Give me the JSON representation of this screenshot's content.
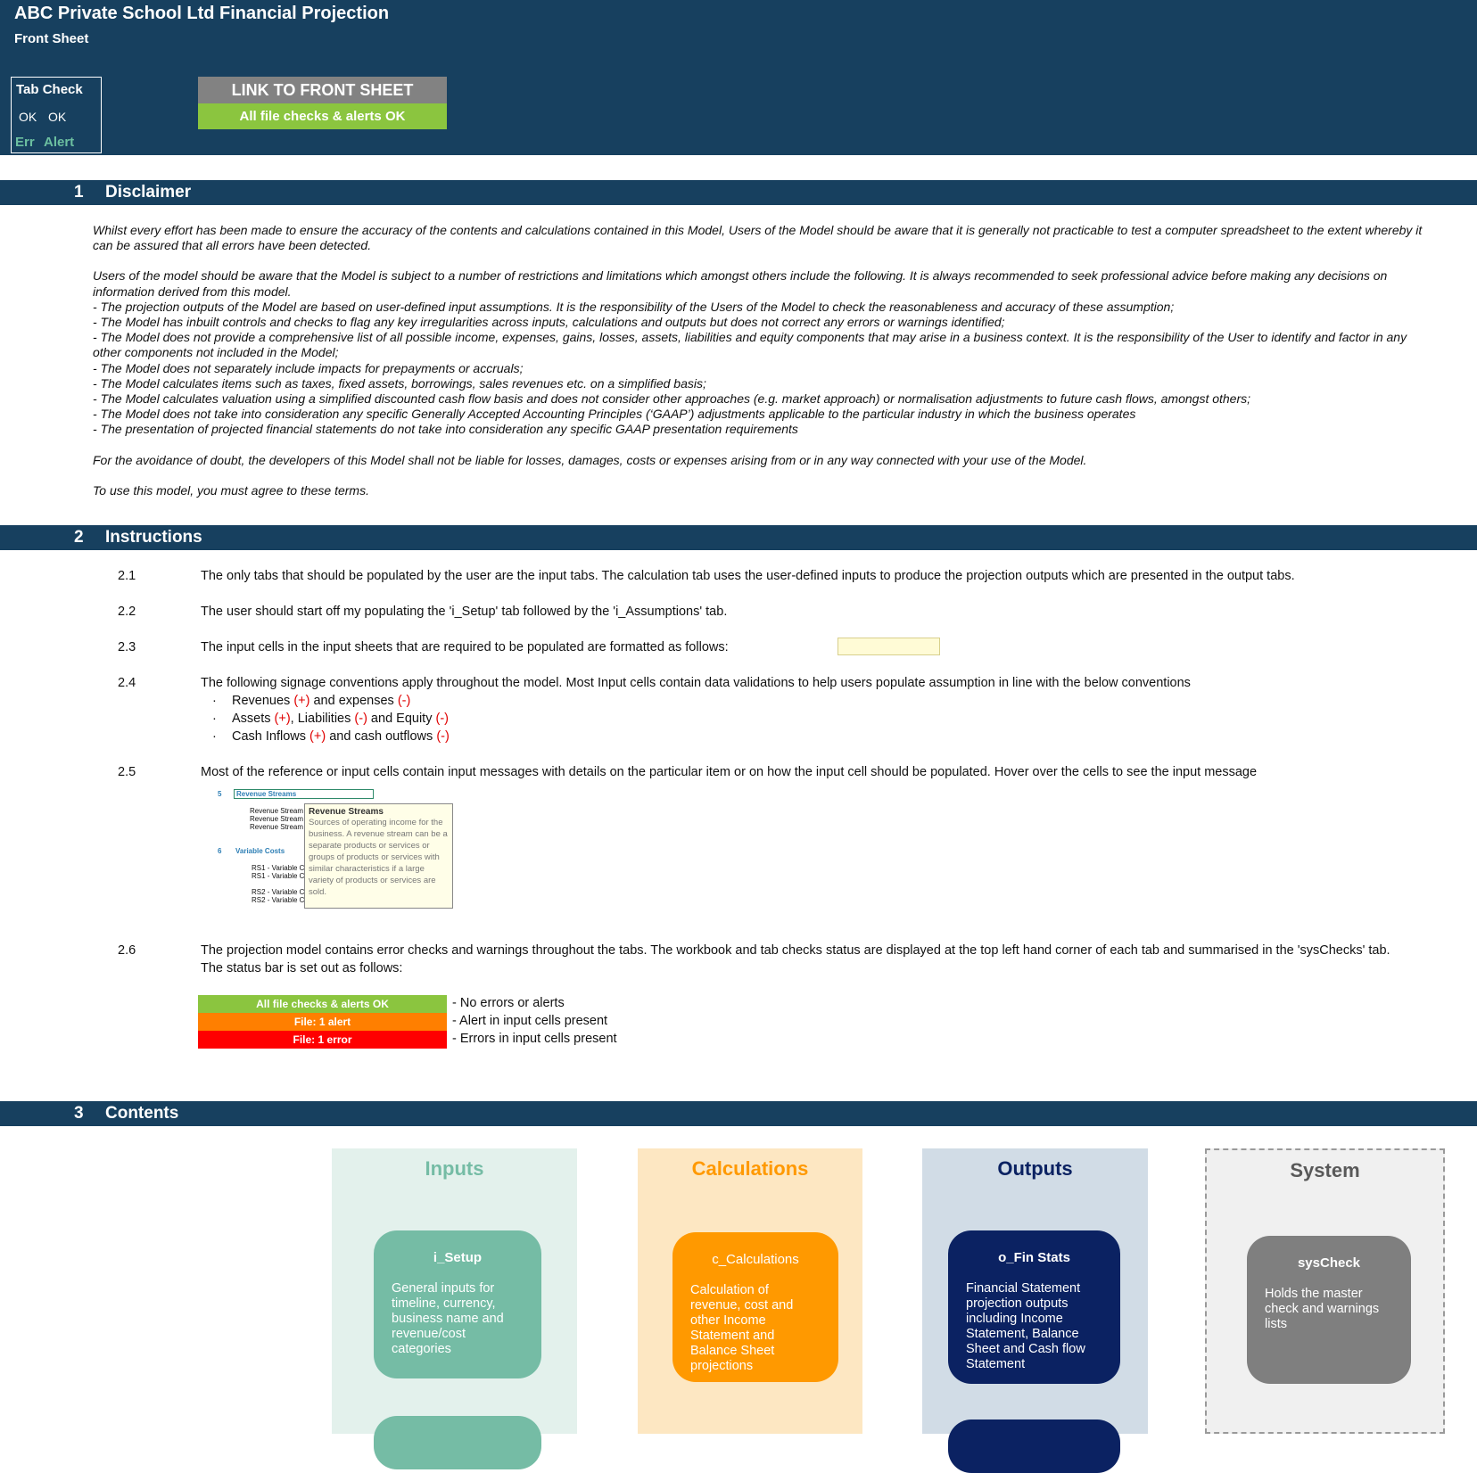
{
  "header": {
    "title": "ABC Private School Ltd Financial Projection",
    "subtitle": "Front Sheet",
    "tab_check": {
      "label": "Tab Check",
      "ok1": "OK",
      "ok2": "OK",
      "err": "Err",
      "alert": "Alert"
    },
    "link_button": "LINK TO FRONT SHEET",
    "status": "All file checks & alerts OK"
  },
  "sections": {
    "disclaimer": {
      "num": "1",
      "label": "Disclaimer"
    },
    "instructions": {
      "num": "2",
      "label": "Instructions"
    },
    "contents": {
      "num": "3",
      "label": "Contents"
    }
  },
  "disclaimer": {
    "p1": "Whilst every effort has been made to ensure the accuracy of the contents and calculations contained in this Model, Users of the Model should be aware that it is generally not practicable to test a computer spreadsheet to the extent whereby it can be assured that all errors have been detected.",
    "p2": "Users of the model should be aware that the Model is subject to a number of restrictions and limitations which amongst others include the following. It is always recommended to seek professional advice before making any decisions on information derived from this model.",
    "bullets": [
      "- The projection outputs of the Model are based on user-defined input assumptions. It is the responsibility of the Users of the Model to check the reasonableness and accuracy of these assumption;",
      "- The Model has inbuilt controls and checks to flag any key irregularities across inputs, calculations and outputs but does not correct any errors or warnings identified;",
      "- The Model does not provide a comprehensive list of all possible income, expenses, gains, losses, assets, liabilities and equity components that may arise in a business context. It is the responsibility of the User to identify and factor in any other components not included in the Model;",
      "- The Model does not separately include impacts for prepayments or accruals;",
      "- The Model calculates items such as taxes, fixed assets, borrowings, sales revenues etc. on a simplified basis;",
      "- The Model calculates valuation using a simplified discounted cash flow basis and does not consider other approaches (e.g. market approach) or normalisation adjustments to future cash flows, amongst others;",
      "- The Model does not take into consideration any specific Generally Accepted Accounting Principles (‘GAAP’) adjustments applicable to the particular industry in which the business operates",
      "- The presentation of projected financial statements do not take into consideration any specific GAAP presentation requirements"
    ],
    "p3": "For the avoidance of doubt, the developers of this Model shall not be liable for losses, damages, costs or expenses arising from or in any way connected with your use of the Model.",
    "p4": "To use this model, you must agree to these terms."
  },
  "instructions": {
    "i1": {
      "num": "2.1",
      "text": "The only tabs that should be populated by the user are the input tabs. The calculation tab uses the user-defined inputs to produce the projection outputs which are presented in the output tabs."
    },
    "i2": {
      "num": "2.2",
      "text": "The user should start off my populating the 'i_Setup' tab followed by the 'i_Assumptions' tab."
    },
    "i3": {
      "num": "2.3",
      "text": "The input cells in the input sheets that are required to be populated are formatted as follows:"
    },
    "i4": {
      "num": "2.4",
      "text": "The following signage conventions apply throughout the model. Most Input cells contain data validations to help users populate assumption in line with the below conventions"
    },
    "conventions": {
      "dot": "·",
      "b1a": "Revenues ",
      "b1b": "(+)",
      "b1c": " and expenses ",
      "b1d": "(-)",
      "b2a": "Assets ",
      "b2b": "(+)",
      "b2c": ", Liabilities ",
      "b2d": "(-)",
      "b2e": " and Equity ",
      "b2f": "(-)",
      "b3a": "Cash Inflows ",
      "b3b": "(+)",
      "b3c": " and cash outflows ",
      "b3d": "(-)"
    },
    "i5": {
      "num": "2.5",
      "text": "Most of the reference or input cells contain input messages with details on the particular item or on how the input cell should be populated. Hover over the cells to see the input message"
    },
    "illustration": {
      "n5": "5",
      "rs_header": "Revenue Streams",
      "rs1": "Revenue Stream",
      "rs2": "Revenue Stream",
      "rs3": "Revenue Stream",
      "n6": "6",
      "vc": "Variable Costs",
      "v1": "RS1 - Variable C",
      "v2": "RS1 - Variable C",
      "v3": "RS2 - Variable C",
      "v4": "RS2 - Variable C",
      "tooltip_title": "Revenue Streams",
      "tooltip_body": "Sources of operating income for the business. A revenue stream can be a separate products or services or groups of products or services with similar characteristics if a large variety of products or services are sold."
    },
    "i6": {
      "num": "2.6",
      "text1": "The projection model contains error checks and warnings throughout the tabs. The workbook and tab checks status are displayed at the top left hand corner of each tab and summarised in the 'sysChecks' tab.",
      "text2": "The status bar is set out as follows:"
    },
    "legend": [
      {
        "label": "All file checks & alerts OK",
        "desc": "- No errors or alerts",
        "color": "#8bc53f"
      },
      {
        "label": "File: 1 alert",
        "desc": "- Alert in input cells present",
        "color": "#ff7f00"
      },
      {
        "label": "File: 1 error",
        "desc": "- Errors in input cells present",
        "color": "#ff0000"
      }
    ]
  },
  "contents": {
    "inputs": {
      "title": "Inputs",
      "card_title": "i_Setup",
      "card_desc": "General inputs for timeline, currency, business name and revenue/cost categories"
    },
    "calculations": {
      "title": "Calculations",
      "card_title": "c_Calculations",
      "card_desc": "Calculation of revenue, cost and other Income Statement and Balance Sheet projections"
    },
    "outputs": {
      "title": "Outputs",
      "card_title": "o_Fin Stats",
      "card_desc": "Financial Statement projection outputs including Income Statement, Balance Sheet and Cash flow Statement"
    },
    "system": {
      "title": "System",
      "card_title": "sysCheck",
      "card_desc": "Holds the master check and warnings lists"
    }
  },
  "colors": {
    "navy": "#17405f",
    "green_ok": "#8bc53f",
    "alert_orange": "#ff7f00",
    "error_red": "#ff0000",
    "inputs_teal": "#75bca5",
    "calc_orange": "#ff9900",
    "outputs_navy": "#0b2262",
    "system_grey": "#7f7f7f"
  }
}
